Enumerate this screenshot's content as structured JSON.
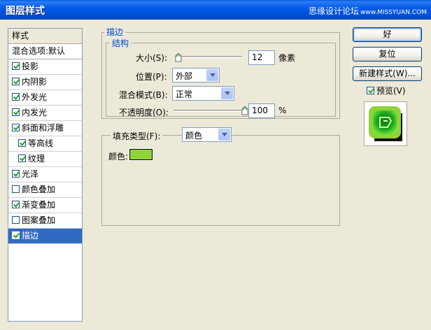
{
  "window": {
    "title": "图层样式",
    "watermark": "思缘设计论坛",
    "watermark_url": "www.MISSYUAN.COM"
  },
  "style_list": {
    "header": "样式",
    "blend_options": "混合选项:默认",
    "items": [
      {
        "label": "投影",
        "checked": true,
        "sub": false
      },
      {
        "label": "内阴影",
        "checked": true,
        "sub": false
      },
      {
        "label": "外发光",
        "checked": true,
        "sub": false
      },
      {
        "label": "内发光",
        "checked": true,
        "sub": false
      },
      {
        "label": "斜面和浮雕",
        "checked": true,
        "sub": false
      },
      {
        "label": "等高线",
        "checked": true,
        "sub": true
      },
      {
        "label": "纹理",
        "checked": true,
        "sub": true
      },
      {
        "label": "光泽",
        "checked": true,
        "sub": false
      },
      {
        "label": "颜色叠加",
        "checked": false,
        "sub": false
      },
      {
        "label": "渐变叠加",
        "checked": true,
        "sub": false
      },
      {
        "label": "图案叠加",
        "checked": false,
        "sub": false
      },
      {
        "label": "描边",
        "checked": true,
        "sub": false,
        "selected": true
      }
    ]
  },
  "stroke": {
    "group_title": "描边",
    "structure_title": "结构",
    "size_label": "大小(S):",
    "size_value": "12",
    "size_unit": "像素",
    "size_fraction": 0.05,
    "position_label": "位置(P):",
    "position_value": "外部",
    "blend_mode_label": "混合模式(B):",
    "blend_mode_value": "正常",
    "opacity_label": "不透明度(O):",
    "opacity_value": "100",
    "opacity_unit": "%",
    "opacity_fraction": 1.0,
    "fill_type_label": "填充类型(F):",
    "fill_type_value": "颜色",
    "color_label": "颜色:",
    "color_value": "#8fd33a"
  },
  "buttons": {
    "ok": "好",
    "reset": "复位",
    "new_style": "新建样式(W)...",
    "preview_label": "预览(V)",
    "preview_checked": true
  }
}
